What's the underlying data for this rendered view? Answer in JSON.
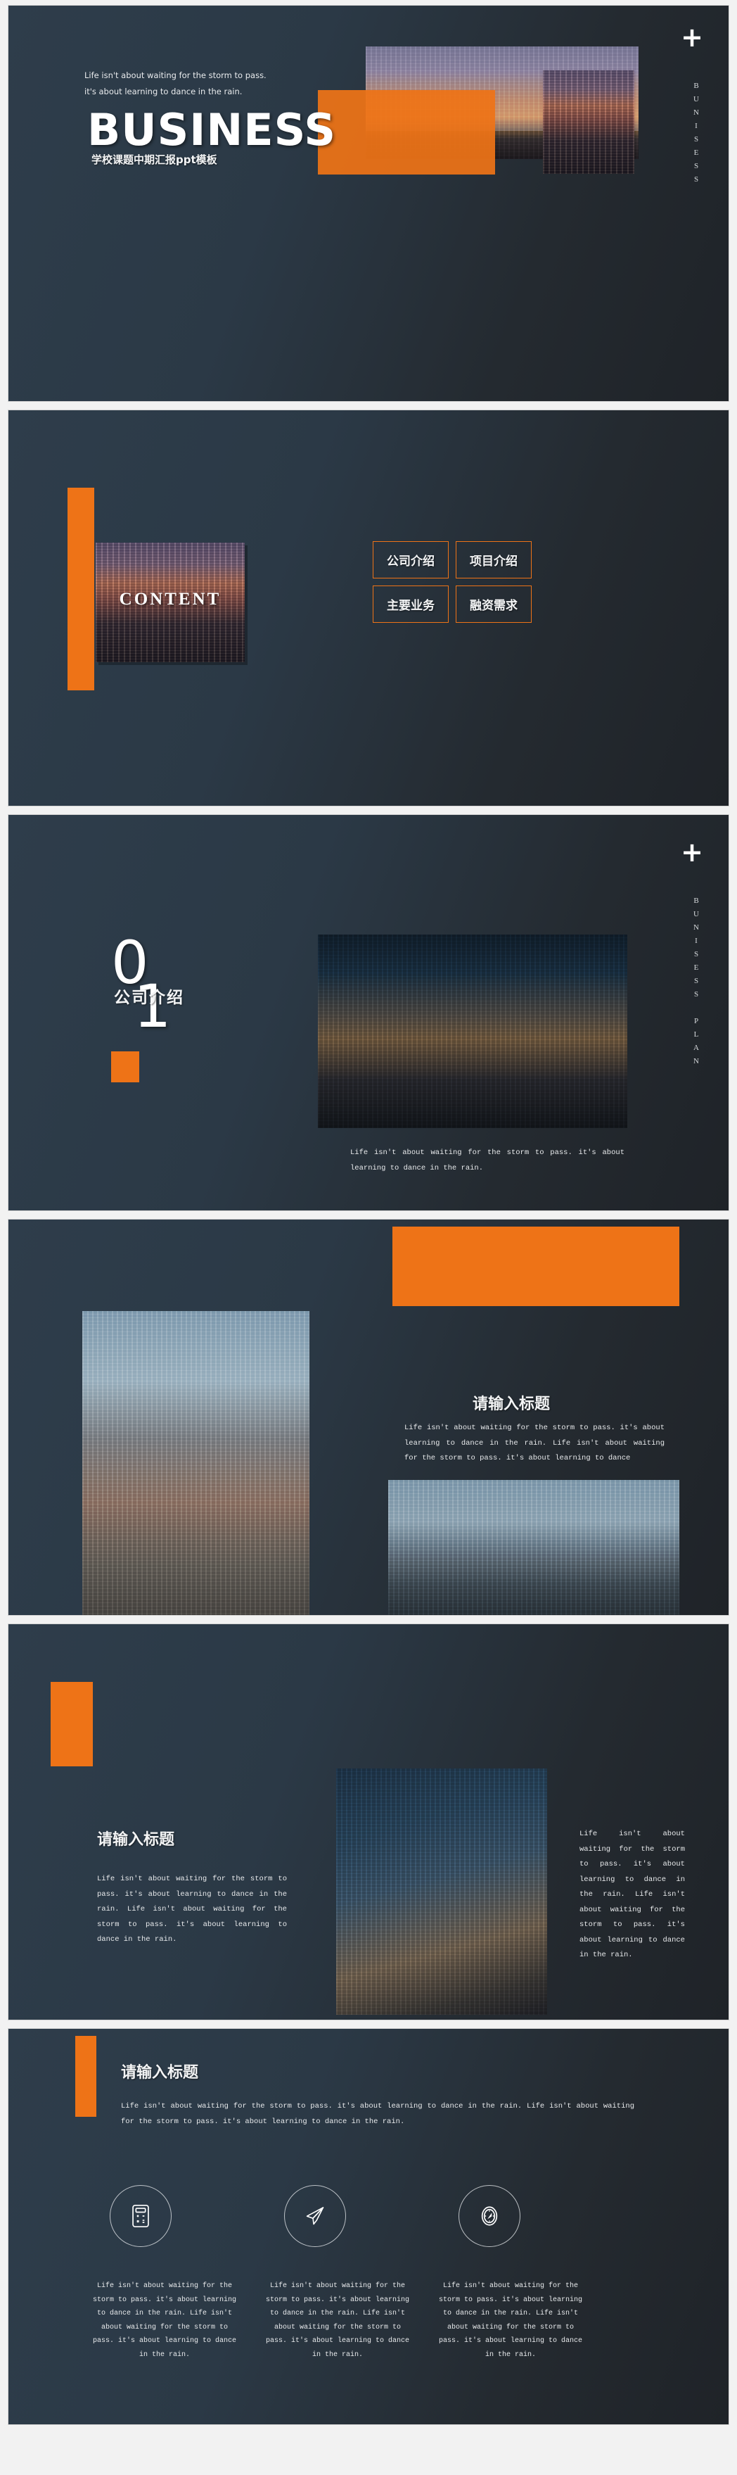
{
  "brand": {
    "orange": "#ee7317",
    "bg_dark": "#2b3946",
    "text_light": "#e9ebed"
  },
  "quote": "Life isn't about waiting for the storm to pass. it's about learning to dance in the rain.",
  "quote_mono": " Life isn't about waiting for the storm to pass. it's about learning to dance in the rain.",
  "slides": [
    {
      "id": "title-slide",
      "quote": " Life isn't about waiting for the storm to pass. it's about learning to dance in the rain.",
      "title": "BUSINESS",
      "subtitle": "学校课题中期汇报ppt模板",
      "vertical_label": "BUNISESS",
      "plus_icon": "+"
    },
    {
      "id": "content-slide",
      "word": "CONTENT",
      "menu": [
        {
          "label": "公司介绍"
        },
        {
          "label": "项目介绍"
        },
        {
          "label": "主要业务"
        },
        {
          "label": "融资需求"
        }
      ]
    },
    {
      "id": "section-divider",
      "number_top": "0",
      "number_bottom": "1",
      "section_title": "公司介绍",
      "vertical_label": "BUNISESS PLAN",
      "plus_icon": "+",
      "caption": "Life isn't about waiting for the storm to pass. it's about learning to dance in the rain."
    },
    {
      "id": "content-slide-a",
      "title": "请输入标题",
      "body": "Life isn't about waiting for the storm to pass. it's about learning to dance in the rain.   Life isn't about waiting for the storm to pass. it's about learning to dance"
    },
    {
      "id": "content-slide-b",
      "title": "请输入标题",
      "body_left": " Life isn't about waiting for the storm to pass. it's about learning to dance in the rain.   Life isn't about waiting for the storm to pass. it's about learning to dance in the rain.",
      "body_right": " Life isn't about waiting for the storm to pass. it's about learning to dance in the rain.   Life isn't about waiting for the storm to pass. it's about learning to dance in the rain."
    },
    {
      "id": "icons-slide",
      "title": "请输入标题",
      "body": " Life isn't about waiting for the storm to pass. it's about learning to dance in the rain.   Life isn't about waiting for the storm to pass. it's about learning to dance in the rain.",
      "columns": [
        {
          "icon": "calculator-icon",
          "text": "Life isn't about waiting for the storm to pass. it's about learning to dance in the rain.   Life isn't about waiting for the storm to pass. it's about learning to dance in the rain."
        },
        {
          "icon": "paper-plane-icon",
          "text": "Life isn't about waiting for the storm to pass. it's about learning to dance in the rain.   Life isn't about waiting for the storm to pass. it's about learning to dance in the rain."
        },
        {
          "icon": "compass-icon",
          "text": "Life isn't about waiting for the storm to pass. it's about learning to dance in the rain.   Life isn't about waiting for the storm to pass. it's about learning to dance in the rain."
        }
      ]
    }
  ]
}
